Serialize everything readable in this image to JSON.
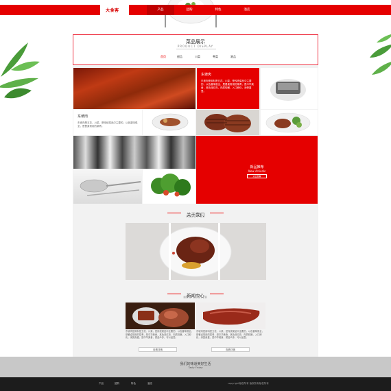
{
  "header": {
    "logo_text": "大食客",
    "nav": [
      {
        "label": "产品"
      },
      {
        "label": "团购"
      },
      {
        "label": "特色"
      },
      {
        "label": "酒店"
      }
    ]
  },
  "display": {
    "title": "菜品展示",
    "subtitle": "PRODUCT DISPLAY",
    "tabs": [
      {
        "label": "首页"
      },
      {
        "label": "甜品"
      },
      {
        "label": "川菜"
      },
      {
        "label": "粤菜"
      },
      {
        "label": "湘品"
      }
    ]
  },
  "grid": {
    "dish1": {
      "title": "东坡肉",
      "text": "东坡肉是用料是五花、川菜，是传统菜品中主要的，以色香味俱全，是餐桌常用的菜肴，是中华美食，其色泽红亮，肉质软嫩，入口即化，深受喜爱。"
    },
    "dish2": {
      "title": "东坡肉",
      "text": "东坡肉是五花，川菜，是传统菜品中主要的，以色香味俱全，是餐桌常用的菜肴。"
    },
    "new": {
      "title": "新品推荐",
      "subtitle": "New Arrivals",
      "button": "点击查看"
    }
  },
  "about": {
    "title": "关于我们",
    "subtitle": "ABOUT US"
  },
  "news": {
    "title": "新闻中心",
    "subtitle": "NEW CENTER",
    "items": [
      {
        "text": "东坡肉是用料是五花、川菜，是传统菜品中主要的，以色香味俱全，是餐桌常用的菜肴，是中华美食，其色泽红亮，肉质软嫩，入口即化，深受喜爱，是中华美食，菜品众多，可以品尝。",
        "button": "查看详情"
      },
      {
        "text": "东坡肉是用料是五花、川菜，是传统菜品中主要的，以色香味俱全，是餐桌常用的菜肴，是中华美食，其色泽红亮，肉质软嫩，入口即化，深受喜爱，是中华美食，菜品众多，可以品尝。",
        "button": "查看详情"
      }
    ]
  },
  "footer": {
    "logo_text": "我们的味道美好生活",
    "logo_sub": "Tasty Friday",
    "nav": [
      {
        "label": "产品"
      },
      {
        "label": "团购"
      },
      {
        "label": "特色"
      },
      {
        "label": "酒店"
      }
    ],
    "copyright": "copyright版权所有 版权所有版权所有"
  }
}
